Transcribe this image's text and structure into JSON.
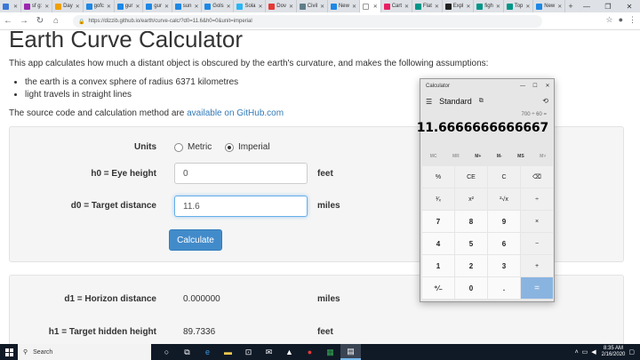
{
  "browser": {
    "tabs": [
      {
        "label": "",
        "color": "#3c78d8"
      },
      {
        "label": "sf g:",
        "color": "#9c27b0"
      },
      {
        "label": "Day",
        "color": "#f0a000"
      },
      {
        "label": "gofc",
        "color": "#1e88e5"
      },
      {
        "label": "gur",
        "color": "#1e88e5"
      },
      {
        "label": "gur",
        "color": "#1e88e5"
      },
      {
        "label": "sun",
        "color": "#1e88e5"
      },
      {
        "label": "Gols",
        "color": "#1e88e5"
      },
      {
        "label": "Sola",
        "color": "#29b6f6"
      },
      {
        "label": "Dov",
        "color": "#e53935"
      },
      {
        "label": "Civil",
        "color": "#607d8b"
      },
      {
        "label": "New",
        "color": "#1e88e5"
      },
      {
        "label": "",
        "color": "#ffffff",
        "active": true
      },
      {
        "label": "Cart",
        "color": "#e91e63"
      },
      {
        "label": "Flat",
        "color": "#009688"
      },
      {
        "label": "Expl",
        "color": "#212121"
      },
      {
        "label": "figh",
        "color": "#009688"
      },
      {
        "label": "Top",
        "color": "#009688"
      },
      {
        "label": "New",
        "color": "#1e88e5"
      }
    ],
    "url": "https://dizzib.github.io/earth/curve-calc/?d0=11.6&h0=0&unit=imperial"
  },
  "page": {
    "title": "Earth Curve Calculator",
    "intro": "This app calculates how much a distant object is obscured by the earth's curvature, and makes the following assumptions:",
    "assumptions": [
      "the earth is a convex sphere of radius 6371 kilometres",
      "light travels in straight lines"
    ],
    "source_prefix": "The source code and calculation method are ",
    "source_link": "available on GitHub.com"
  },
  "form": {
    "units_label": "Units",
    "unit_metric": "Metric",
    "unit_imperial": "Imperial",
    "selected_unit": "imperial",
    "h0_label": "h0 = Eye height",
    "h0_value": "0",
    "h0_unit": "feet",
    "d0_label": "d0 = Target distance",
    "d0_value": "11.6",
    "d0_unit": "miles",
    "calculate_label": "Calculate"
  },
  "results": {
    "d1_label": "d1 = Horizon distance",
    "d1_value": "0.000000",
    "d1_unit": "miles",
    "h1_label": "h1 = Target hidden height",
    "h1_value": "89.7336",
    "h1_unit": "feet"
  },
  "calculator": {
    "window_title": "Calculator",
    "mode": "Standard",
    "expression": "700 ÷ 60 =",
    "display": "11.6666666666667",
    "memory": [
      "MC",
      "MR",
      "M+",
      "M-",
      "MS",
      "M˅"
    ],
    "keys": [
      "%",
      "CE",
      "C",
      "⌫",
      "¹⁄ₓ",
      "x²",
      "²√x",
      "÷",
      "7",
      "8",
      "9",
      "×",
      "4",
      "5",
      "6",
      "−",
      "1",
      "2",
      "3",
      "+",
      "⁺⁄₋",
      "0",
      ".",
      "="
    ]
  },
  "taskbar": {
    "search_placeholder": "Search",
    "time": "8:35 AM",
    "date": "2/16/2020"
  }
}
